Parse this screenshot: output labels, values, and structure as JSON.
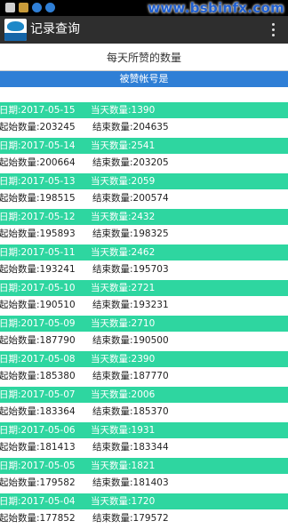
{
  "watermark": "www.bsbinfx.com",
  "app": {
    "title": "记录查询"
  },
  "page": {
    "title": "每天所赞的数量",
    "account_label": "被赞帐号是"
  },
  "records": [
    {
      "date": "日期:2017-05-15",
      "today": "当天数量:1390",
      "start": "起始数量:203245",
      "end": "结束数量:204635"
    },
    {
      "date": "日期:2017-05-14",
      "today": "当天数量:2541",
      "start": "起始数量:200664",
      "end": "结束数量:203205"
    },
    {
      "date": "日期:2017-05-13",
      "today": "当天数量:2059",
      "start": "起始数量:198515",
      "end": "结束数量:200574"
    },
    {
      "date": "日期:2017-05-12",
      "today": "当天数量:2432",
      "start": "起始数量:195893",
      "end": "结束数量:198325"
    },
    {
      "date": "日期:2017-05-11",
      "today": "当天数量:2462",
      "start": "起始数量:193241",
      "end": "结束数量:195703"
    },
    {
      "date": "日期:2017-05-10",
      "today": "当天数量:2721",
      "start": "起始数量:190510",
      "end": "结束数量:193231"
    },
    {
      "date": "日期:2017-05-09",
      "today": "当天数量:2710",
      "start": "起始数量:187790",
      "end": "结束数量:190500"
    },
    {
      "date": "日期:2017-05-08",
      "today": "当天数量:2390",
      "start": "起始数量:185380",
      "end": "结束数量:187770"
    },
    {
      "date": "日期:2017-05-07",
      "today": "当天数量:2006",
      "start": "起始数量:183364",
      "end": "结束数量:185370"
    },
    {
      "date": "日期:2017-05-06",
      "today": "当天数量:1931",
      "start": "起始数量:181413",
      "end": "结束数量:183344"
    },
    {
      "date": "日期:2017-05-05",
      "today": "当天数量:1821",
      "start": "起始数量:179582",
      "end": "结束数量:181403"
    },
    {
      "date": "日期:2017-05-04",
      "today": "当天数量:1720",
      "start": "起始数量:177852",
      "end": "结束数量:179572"
    }
  ]
}
